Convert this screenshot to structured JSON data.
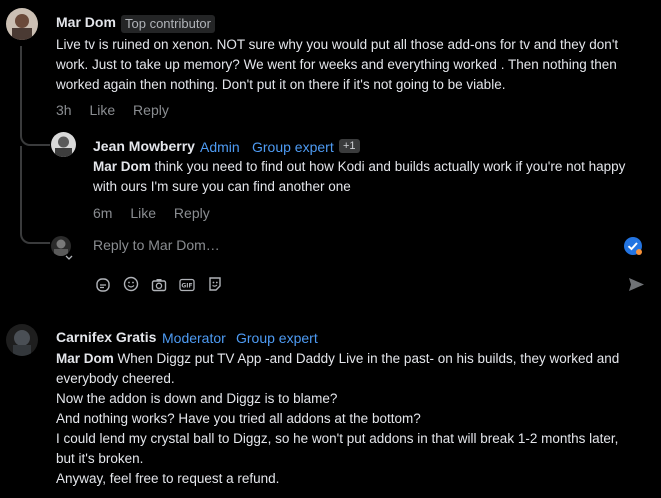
{
  "comments": [
    {
      "author": "Mar Dom",
      "badge": "Top contributor",
      "text": "Live tv is ruined on xenon. NOT sure why you would put all those add-ons for tv and they don't work. Just to take up memory? We went for weeks and everything worked . Then nothing then worked again then nothing. Don't put it on there if it's not going to be viable.",
      "time": "3h",
      "like": "Like",
      "reply": "Reply"
    },
    {
      "author": "Jean Mowberry",
      "roles": [
        "Admin",
        "Group expert"
      ],
      "extra": "+1",
      "mention": "Mar Dom",
      "text": " think you need to find out how Kodi and builds actually work if you're not happy with ours I'm sure you can find another one",
      "time": "6m",
      "like": "Like",
      "reply": "Reply"
    },
    {
      "author": "Carnifex Gratis",
      "roles": [
        "Moderator",
        "Group expert"
      ],
      "mention": "Mar Dom",
      "lines": [
        " When Diggz put TV App -and Daddy Live in the past- on his builds, they worked and everybody cheered.",
        "Now the addon is down and Diggz is to blame?",
        "And nothing works? Have you tried all addons at the bottom?",
        "I could lend my crystal ball to Diggz, so he won't put addons in that will break 1-2 months later, but it's broken.",
        "Anyway, feel free to request a refund."
      ]
    }
  ],
  "reply_box": {
    "placeholder": "Reply to Mar Dom…"
  },
  "icons": [
    "sticker-icon",
    "emoji-icon",
    "camera-icon",
    "gif-icon",
    "avatar-sticker-icon",
    "send-icon",
    "checkmark-badge-icon"
  ],
  "colors": {
    "background": "#000000",
    "role_blue": "#4e9bf3",
    "meta_gray": "#8a8d91",
    "text": "#e4e6eb"
  }
}
